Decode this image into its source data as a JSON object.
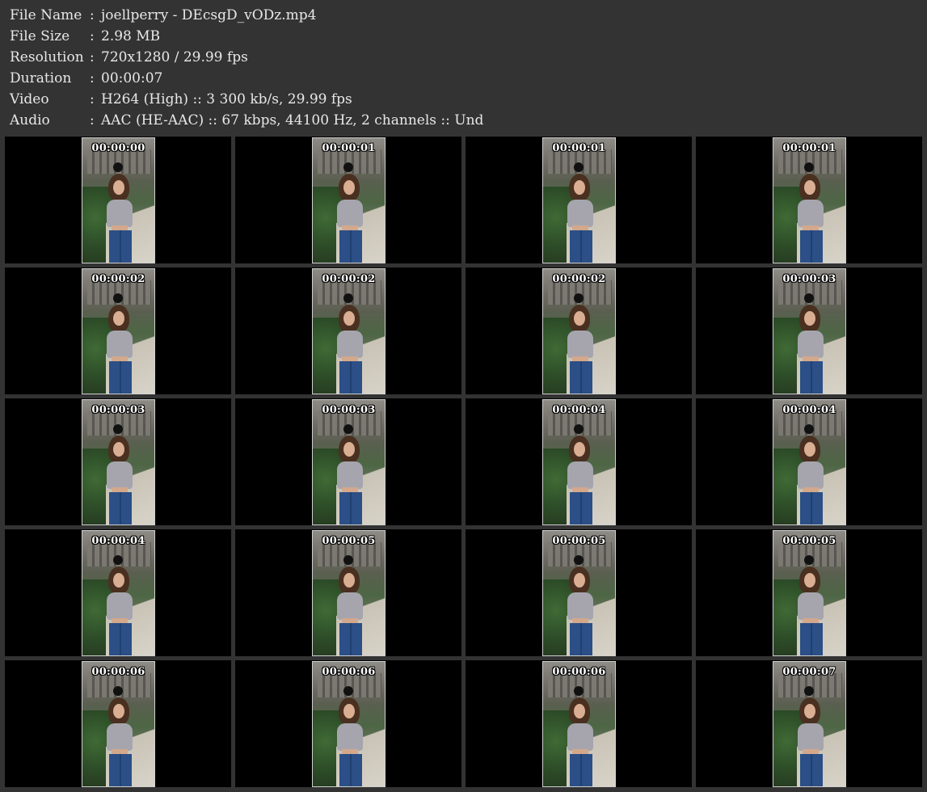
{
  "info": [
    {
      "label": "File Name",
      "value": "joellperry - DEcsgD_vODz.mp4"
    },
    {
      "label": "File Size",
      "value": "2.98 MB"
    },
    {
      "label": "Resolution",
      "value": "720x1280 / 29.99 fps"
    },
    {
      "label": "Duration",
      "value": "00:00:07"
    },
    {
      "label": "Video",
      "value": "H264 (High) :: 3 300 kb/s, 29.99 fps"
    },
    {
      "label": "Audio",
      "value": "AAC (HE-AAC) :: 67 kbps, 44100 Hz, 2 channels :: Und"
    }
  ],
  "separator": ":",
  "thumbnails": [
    "00:00:00",
    "00:00:01",
    "00:00:01",
    "00:00:01",
    "00:00:02",
    "00:00:02",
    "00:00:02",
    "00:00:03",
    "00:00:03",
    "00:00:03",
    "00:00:04",
    "00:00:04",
    "00:00:04",
    "00:00:05",
    "00:00:05",
    "00:00:05",
    "00:00:06",
    "00:00:06",
    "00:00:06",
    "00:00:07"
  ]
}
